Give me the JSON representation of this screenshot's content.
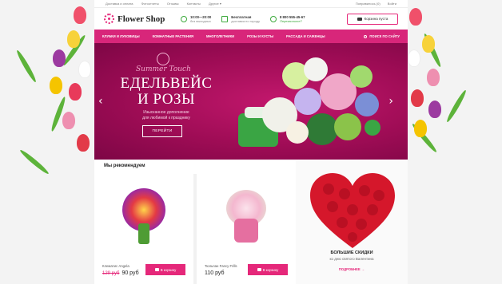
{
  "topbar": {
    "links": [
      "Доставка и оплата",
      "Фотоотчеты",
      "Отзывы",
      "Контакты",
      "Другое ▾"
    ],
    "account": [
      "Понравилось (0)",
      "Войти"
    ]
  },
  "header": {
    "logo_text": "Flower Shop",
    "hours_title": "10:00—20:00",
    "hours_sub": "без выходных",
    "delivery_title": "Бесплатная",
    "delivery_sub": "доставка по городу",
    "phone_title": "8 800 555-45-67",
    "phone_sub": "Перезвоните?",
    "cart_label": "Корзина пуста"
  },
  "nav": {
    "items": [
      "Клубки и луковицы",
      "Комнатные растения",
      "Многолетники",
      "Розы и кусты",
      "Рассада и саженцы"
    ],
    "search_label": "Поиск по сайту"
  },
  "hero": {
    "script": "Summer Touch",
    "title_line1": "ЕДЕЛЬВЕЙС",
    "title_line2": "И РОЗЫ",
    "sub_line1": "Изысканное дополнение",
    "sub_line2": "для любимой к празднику",
    "cta": "ПЕРЕЙТИ",
    "prev": "‹",
    "next": "›"
  },
  "recommend": {
    "title": "Мы рекомендуем",
    "products": [
      {
        "name": "Клематис Angela",
        "old_price": "129 руб",
        "price": "90 руб",
        "buy": "В корзину"
      },
      {
        "name": "Тюльпан Fancy Frills",
        "old_price": "",
        "price": "110 руб",
        "buy": "В корзину"
      }
    ]
  },
  "promo": {
    "title": "БОЛЬШИЕ СКИДКИ",
    "subtitle": "ко дню святого Валентина",
    "more": "ПОДРОБНЕЕ →"
  },
  "colors": {
    "accent": "#e5287a",
    "nav": "#d8267a",
    "hero": "#9e0c55",
    "green": "#3caa3c"
  }
}
